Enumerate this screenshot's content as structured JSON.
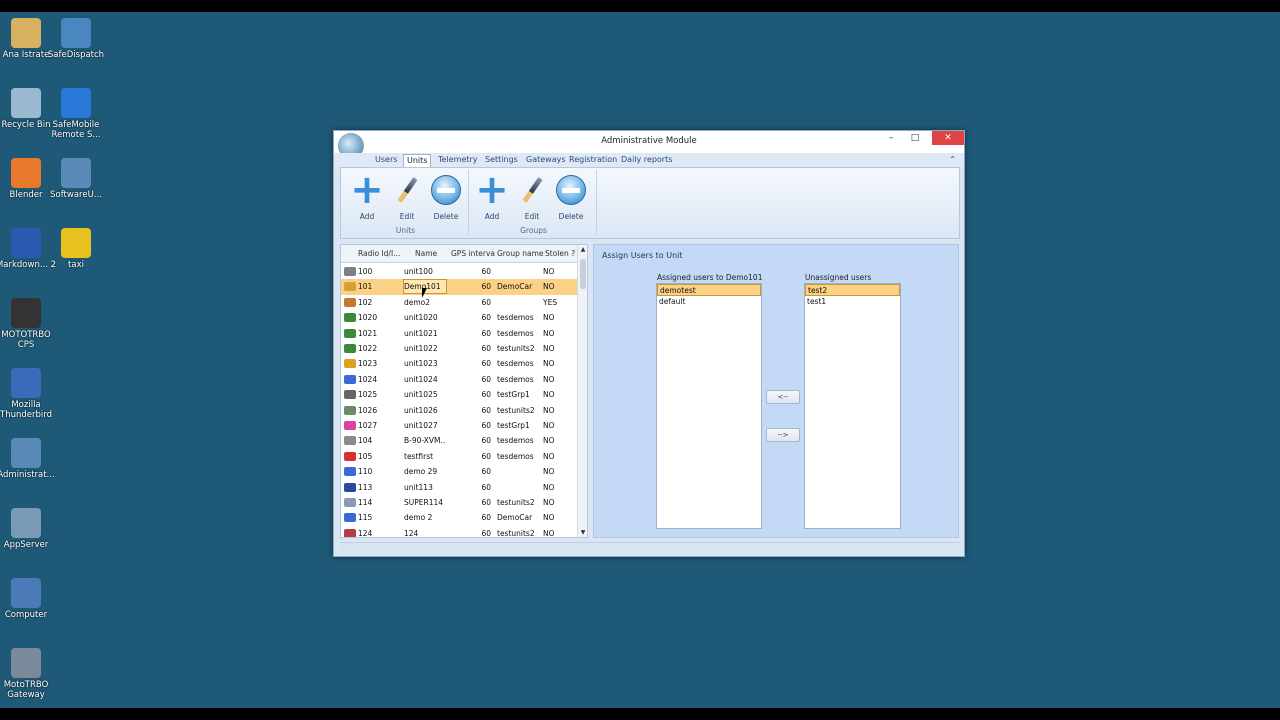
{
  "desktop": {
    "icons": [
      {
        "label": "Ana Istrate",
        "icon": "folder-user-icon",
        "color": "#d8b060"
      },
      {
        "label": "SafeDispatch",
        "icon": "safedispatch-icon",
        "color": "#4a86c0"
      },
      {
        "label": "Recycle Bin",
        "icon": "recycle-bin-icon",
        "color": "#9ab8d0"
      },
      {
        "label": "SafeMobile Remote S...",
        "icon": "teamviewer-icon",
        "color": "#2a78d8"
      },
      {
        "label": "Blender",
        "icon": "blender-icon",
        "color": "#e8782a"
      },
      {
        "label": "SoftwareU...",
        "icon": "software-update-icon",
        "color": "#5a8ab8"
      },
      {
        "label": "Markdown... 2",
        "icon": "markdownpad-icon",
        "color": "#2a5ab0"
      },
      {
        "label": "taxi",
        "icon": "taxi-icon",
        "color": "#e8c020"
      },
      {
        "label": "MOTOTRBO CPS",
        "icon": "mototrbo-cps-icon",
        "color": "#333333"
      },
      {
        "label": "Mozilla Thunderbird",
        "icon": "thunderbird-icon",
        "color": "#3a6ab8"
      },
      {
        "label": "Administrat...",
        "icon": "admin-module-icon",
        "color": "#5a8ab8"
      },
      {
        "label": "AppServer",
        "icon": "appserver-icon",
        "color": "#7a9ab8"
      },
      {
        "label": "Computer",
        "icon": "computer-icon",
        "color": "#4a7ab8"
      },
      {
        "label": "MotoTRBO Gateway",
        "icon": "mototrbo-gateway-icon",
        "color": "#7a8a9a"
      }
    ]
  },
  "window": {
    "title": "Administrative Module",
    "minimize": "–",
    "maximize": "□",
    "close": "✕"
  },
  "menu": {
    "tabs": [
      "Users",
      "Units",
      "Telemetry",
      "Settings",
      "Gateways",
      "Registration",
      "Daily reports"
    ],
    "active": "Units",
    "collapse": "⌃"
  },
  "ribbon": {
    "groups": [
      {
        "label": "Units",
        "buttons": [
          "Add",
          "Edit",
          "Delete"
        ]
      },
      {
        "label": "Groups",
        "buttons": [
          "Add",
          "Edit",
          "Delete"
        ]
      }
    ]
  },
  "grid": {
    "columns": [
      "Radio Id/I...",
      "Name",
      "GPS interval",
      "Group name",
      "Stolen ?"
    ],
    "rows": [
      {
        "id": "100",
        "name": "unit100",
        "gps": "60",
        "group": "",
        "stolen": "NO",
        "icon_color": "#7a8088"
      },
      {
        "id": "101",
        "name": "Demo101",
        "gps": "60",
        "group": "DemoCar",
        "stolen": "NO",
        "icon_color": "#d8a030",
        "selected": true
      },
      {
        "id": "102",
        "name": "demo2",
        "gps": "60",
        "group": "",
        "stolen": "YES",
        "icon_color": "#c87830"
      },
      {
        "id": "1020",
        "name": "unit1020",
        "gps": "60",
        "group": "tesdemos",
        "stolen": "NO",
        "icon_color": "#3a8a3a"
      },
      {
        "id": "1021",
        "name": "unit1021",
        "gps": "60",
        "group": "tesdemos",
        "stolen": "NO",
        "icon_color": "#3a8a3a"
      },
      {
        "id": "1022",
        "name": "unit1022",
        "gps": "60",
        "group": "testunits2",
        "stolen": "NO",
        "icon_color": "#3a8a3a"
      },
      {
        "id": "1023",
        "name": "unit1023",
        "gps": "60",
        "group": "tesdemos",
        "stolen": "NO",
        "icon_color": "#e0a020"
      },
      {
        "id": "1024",
        "name": "unit1024",
        "gps": "60",
        "group": "tesdemos",
        "stolen": "NO",
        "icon_color": "#3a6ad8"
      },
      {
        "id": "1025",
        "name": "unit1025",
        "gps": "60",
        "group": "testGrp1",
        "stolen": "NO",
        "icon_color": "#666666"
      },
      {
        "id": "1026",
        "name": "unit1026",
        "gps": "60",
        "group": "testunits2",
        "stolen": "NO",
        "icon_color": "#6a8a6a"
      },
      {
        "id": "1027",
        "name": "unit1027",
        "gps": "60",
        "group": "testGrp1",
        "stolen": "NO",
        "icon_color": "#e040a0"
      },
      {
        "id": "104",
        "name": "B-90-XVM...",
        "gps": "60",
        "group": "tesdemos",
        "stolen": "NO",
        "icon_color": "#8a8a8a"
      },
      {
        "id": "105",
        "name": "testfirst",
        "gps": "60",
        "group": "tesdemos",
        "stolen": "NO",
        "icon_color": "#d83030"
      },
      {
        "id": "110",
        "name": "demo 29",
        "gps": "60",
        "group": "",
        "stolen": "NO",
        "icon_color": "#3a6ad8"
      },
      {
        "id": "113",
        "name": "unit113",
        "gps": "60",
        "group": "",
        "stolen": "NO",
        "icon_color": "#2a4a9a"
      },
      {
        "id": "114",
        "name": "SUPER114",
        "gps": "60",
        "group": "testunits2",
        "stolen": "NO",
        "icon_color": "#8a9ab8"
      },
      {
        "id": "115",
        "name": "demo  2",
        "gps": "60",
        "group": "DemoCar",
        "stolen": "NO",
        "icon_color": "#3a6ad8"
      },
      {
        "id": "124",
        "name": "124",
        "gps": "60",
        "group": "testunits2",
        "stolen": "NO",
        "icon_color": "#b04040"
      }
    ]
  },
  "assign": {
    "title": "Assign Users to Unit",
    "assigned_label": "Assigned users to Demo101",
    "unassigned_label": "Unassigned users",
    "assigned": [
      "demotest",
      "default"
    ],
    "unassigned": [
      "test2",
      "test1"
    ],
    "move_left": "<--",
    "move_right": "-->"
  },
  "colors": {
    "desktop_bg": "#1e5a78",
    "selection": "#fbd186",
    "close": "#e04343",
    "panel": "#c3d9f6"
  }
}
